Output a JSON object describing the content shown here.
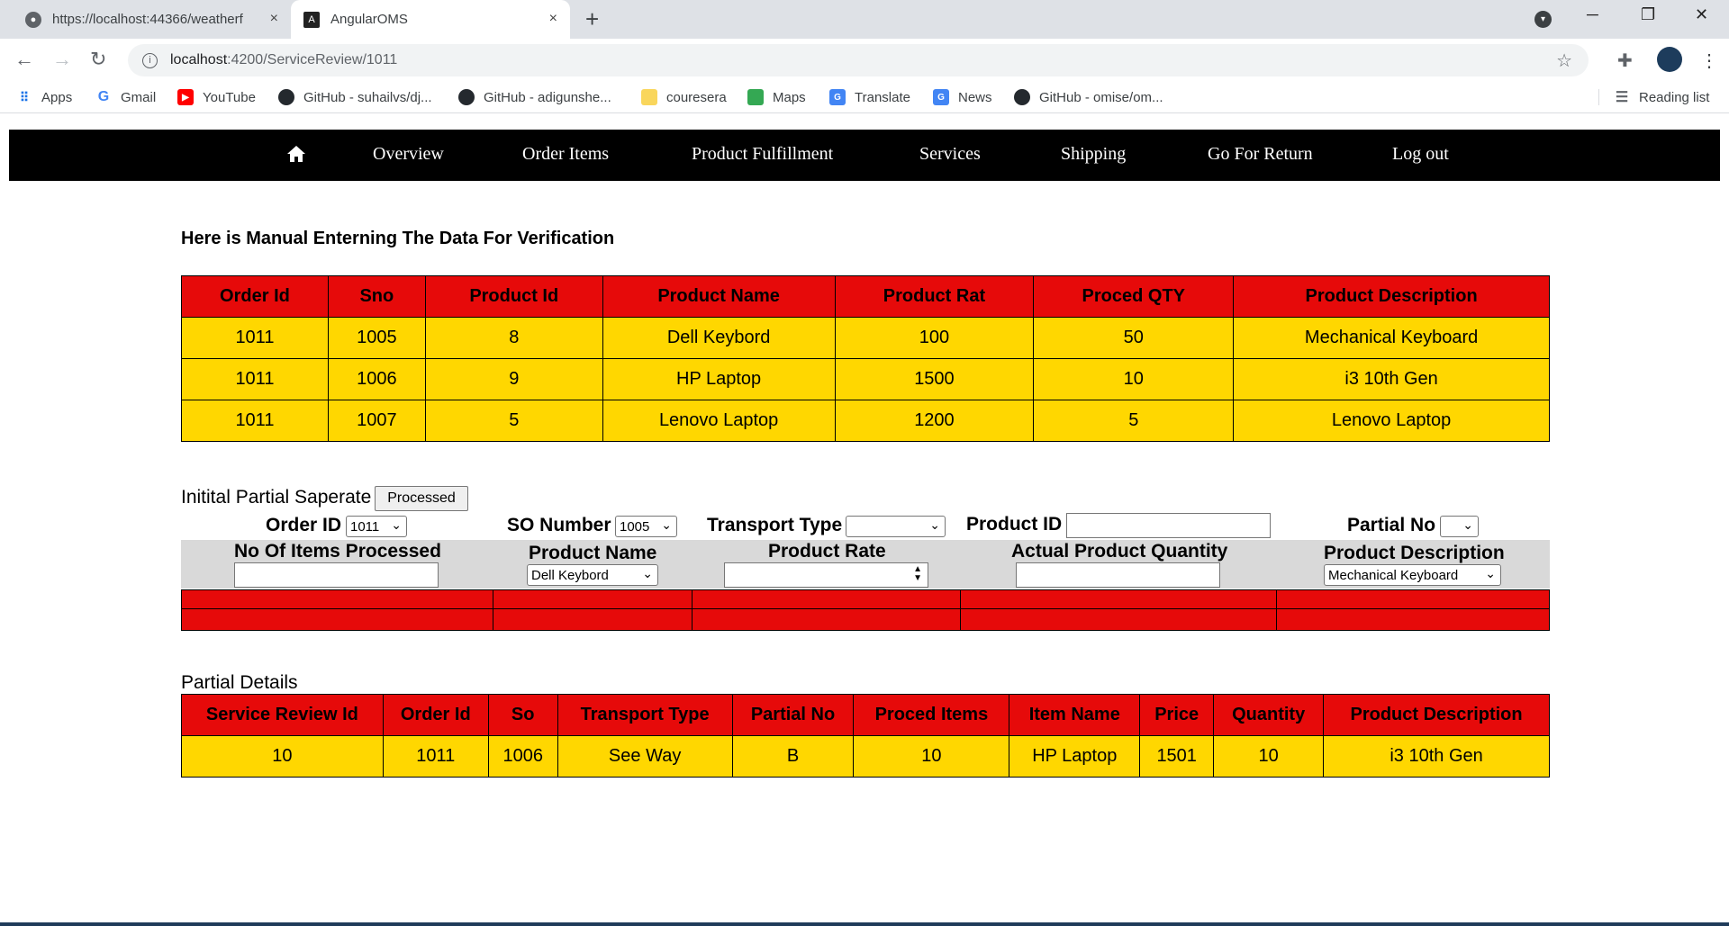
{
  "browser": {
    "tabs": [
      {
        "title": "https://localhost:44366/weatherf",
        "close": "×"
      },
      {
        "title": "AngularOMS",
        "close": "×"
      }
    ],
    "url_host": "localhost",
    "url_rest": ":4200/ServiceReview/1011",
    "bookmarks": [
      "Apps",
      "Gmail",
      "YouTube",
      "GitHub - suhailvs/dj...",
      "GitHub - adigunshe...",
      "couresera",
      "Maps",
      "Translate",
      "News",
      "GitHub - omise/om..."
    ],
    "reading_list": "Reading list"
  },
  "nav": {
    "items": [
      "Overview",
      "Order Items",
      "Product Fulfillment",
      "Services",
      "Shipping",
      "Go For Return",
      "Log out"
    ]
  },
  "heading": "Here is Manual Enterning The Data For Verification",
  "order_table": {
    "headers": [
      "Order Id",
      "Sno",
      "Product Id",
      "Product Name",
      "Product Rat",
      "Proced QTY",
      "Product Description"
    ],
    "rows": [
      [
        "1011",
        "1005",
        "8",
        "Dell Keybord",
        "100",
        "50",
        "Mechanical Keyboard"
      ],
      [
        "1011",
        "1006",
        "9",
        "HP Laptop",
        "1500",
        "10",
        "i3 10th Gen"
      ],
      [
        "1011",
        "1007",
        "5",
        "Lenovo Laptop",
        "1200",
        "5",
        "Lenovo Laptop"
      ]
    ]
  },
  "form": {
    "section_label": "Initital Partial Saperate",
    "processed_button": "Processed",
    "order_id_label": "Order ID",
    "order_id_value": "1011",
    "so_number_label": "SO Number",
    "so_number_value": "1005",
    "transport_type_label": "Transport Type",
    "transport_type_value": "",
    "product_id_label": "Product ID",
    "product_id_value": "",
    "partial_no_label": "Partial No",
    "partial_no_value": "",
    "items_processed_label": "No Of Items Processed",
    "product_name_label": "Product Name",
    "product_name_value": "Dell Keybord",
    "product_rate_label": "Product Rate",
    "actual_qty_label": "Actual Product Quantity",
    "product_desc_label": "Product Description",
    "product_desc_value": "Mechanical Keyboard"
  },
  "partial_details": {
    "label": "Partial Details",
    "headers": [
      "Service Review Id",
      "Order Id",
      "So",
      "Transport Type",
      "Partial No",
      "Proced Items",
      "Item Name",
      "Price",
      "Quantity",
      "Product Description"
    ],
    "rows": [
      [
        "10",
        "1011",
        "1006",
        "See Way",
        "B",
        "10",
        "HP Laptop",
        "1501",
        "10",
        "i3 10th Gen"
      ]
    ]
  },
  "colors": {
    "header_red": "#e60a0a",
    "row_yellow": "#ffd700",
    "navbar": "#000000"
  }
}
